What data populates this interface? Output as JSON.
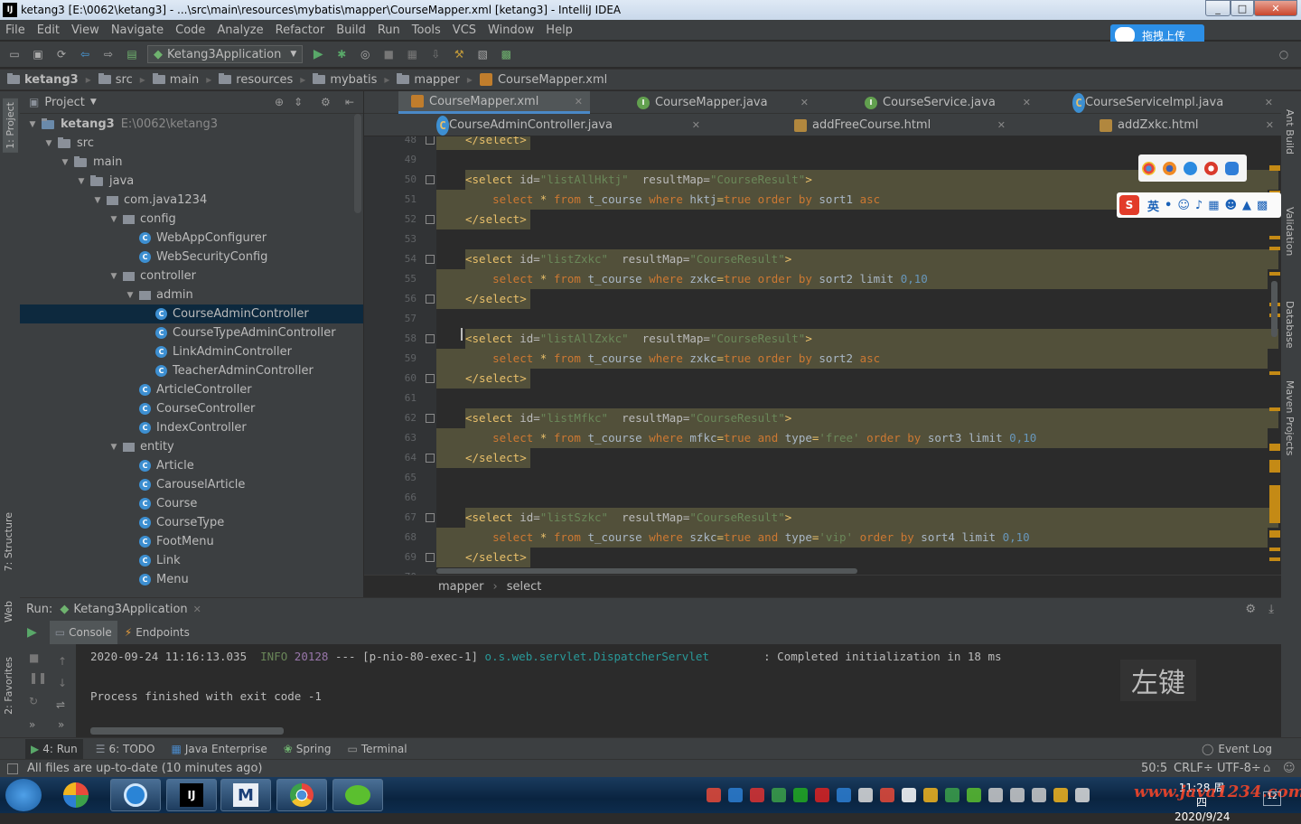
{
  "window": {
    "title": "ketang3 [E:\\0062\\ketang3] - ...\\src\\main\\resources\\mybatis\\mapper\\CourseMapper.xml [ketang3] - IntelliJ IDEA",
    "app_icon": "IJ",
    "controls": [
      "_",
      "□",
      "✕"
    ]
  },
  "menu": [
    "File",
    "Edit",
    "View",
    "Navigate",
    "Code",
    "Analyze",
    "Refactor",
    "Build",
    "Run",
    "Tools",
    "VCS",
    "Window",
    "Help"
  ],
  "upload_button": "拖拽上传",
  "toolbar": {
    "run_config": "Ketang3Application"
  },
  "breadcrumbs": [
    "ketang3",
    "src",
    "main",
    "resources",
    "mybatis",
    "mapper",
    "CourseMapper.xml"
  ],
  "left_strip": {
    "project": "1: Project",
    "structure": "7: Structure",
    "web": "Web",
    "favorites": "2: Favorites"
  },
  "right_strip": {
    "ant": "Ant Build",
    "validation": "Validation",
    "database": "Database",
    "maven": "Maven Projects"
  },
  "project_panel": {
    "title": "Project",
    "root_path": "E:\\0062\\ketang3",
    "tree": [
      {
        "label": "ketang3",
        "kind": "module",
        "depth": 0,
        "open": true
      },
      {
        "label": "src",
        "kind": "folder",
        "depth": 1,
        "open": true
      },
      {
        "label": "main",
        "kind": "folder",
        "depth": 2,
        "open": true
      },
      {
        "label": "java",
        "kind": "folder",
        "depth": 3,
        "open": true
      },
      {
        "label": "com.java1234",
        "kind": "package",
        "depth": 4,
        "open": true
      },
      {
        "label": "config",
        "kind": "package",
        "depth": 5,
        "open": true
      },
      {
        "label": "WebAppConfigurer",
        "kind": "class",
        "depth": 6
      },
      {
        "label": "WebSecurityConfig",
        "kind": "class",
        "depth": 6
      },
      {
        "label": "controller",
        "kind": "package",
        "depth": 5,
        "open": true
      },
      {
        "label": "admin",
        "kind": "package",
        "depth": 6,
        "open": true
      },
      {
        "label": "CourseAdminController",
        "kind": "class",
        "depth": 7,
        "selected": true
      },
      {
        "label": "CourseTypeAdminController",
        "kind": "class",
        "depth": 7
      },
      {
        "label": "LinkAdminController",
        "kind": "class",
        "depth": 7
      },
      {
        "label": "TeacherAdminController",
        "kind": "class",
        "depth": 7
      },
      {
        "label": "ArticleController",
        "kind": "class",
        "depth": 6
      },
      {
        "label": "CourseController",
        "kind": "class",
        "depth": 6
      },
      {
        "label": "IndexController",
        "kind": "class",
        "depth": 6
      },
      {
        "label": "entity",
        "kind": "package",
        "depth": 5,
        "open": true
      },
      {
        "label": "Article",
        "kind": "class",
        "depth": 6
      },
      {
        "label": "CarouselArticle",
        "kind": "class",
        "depth": 6
      },
      {
        "label": "Course",
        "kind": "class",
        "depth": 6
      },
      {
        "label": "CourseType",
        "kind": "class",
        "depth": 6
      },
      {
        "label": "FootMenu",
        "kind": "class",
        "depth": 6
      },
      {
        "label": "Link",
        "kind": "class",
        "depth": 6
      },
      {
        "label": "Menu",
        "kind": "class",
        "depth": 6
      }
    ]
  },
  "editor_tabs_row1": [
    {
      "label": "CourseMapper.xml",
      "type": "xml",
      "active": true
    },
    {
      "label": "CourseMapper.java",
      "type": "interface"
    },
    {
      "label": "CourseService.java",
      "type": "interface"
    },
    {
      "label": "CourseServiceImpl.java",
      "type": "class"
    }
  ],
  "editor_tabs_row2": [
    {
      "label": "CourseAdminController.java",
      "type": "class"
    },
    {
      "label": "addFreeCourse.html",
      "type": "html"
    },
    {
      "label": "addZxkc.html",
      "type": "html"
    }
  ],
  "code": [
    {
      "n": "48",
      "tokens": [
        [
          "tag",
          "</select>"
        ]
      ],
      "hl": true
    },
    {
      "n": "49",
      "tokens": []
    },
    {
      "n": "50",
      "tokens": [
        [
          "tag",
          "<select "
        ],
        [
          "attr",
          "id="
        ],
        [
          "str",
          "\"listAllHktj\""
        ],
        [
          "attr",
          "  resultMap="
        ],
        [
          "str",
          "\"CourseResult\""
        ],
        [
          "tag",
          ">"
        ]
      ],
      "hl": true
    },
    {
      "n": "51",
      "tokens": [
        [
          "kw",
          "    select "
        ],
        [
          "tag",
          "* "
        ],
        [
          "kw",
          "from "
        ],
        [
          "txt",
          "t_course "
        ],
        [
          "kw",
          "where "
        ],
        [
          "txt",
          "hktj"
        ],
        [
          "tag",
          "="
        ],
        [
          "kw",
          "true "
        ],
        [
          "kw",
          "order by "
        ],
        [
          "txt",
          "sort1 "
        ],
        [
          "kw",
          "asc"
        ]
      ],
      "hl": true
    },
    {
      "n": "52",
      "tokens": [
        [
          "tag",
          "</select>"
        ]
      ],
      "hl": true
    },
    {
      "n": "53",
      "tokens": []
    },
    {
      "n": "54",
      "tokens": [
        [
          "tag",
          "<select "
        ],
        [
          "attr",
          "id="
        ],
        [
          "str",
          "\"listZxkc\""
        ],
        [
          "attr",
          "  resultMap="
        ],
        [
          "str",
          "\"CourseResult\""
        ],
        [
          "tag",
          ">"
        ]
      ],
      "hl": true
    },
    {
      "n": "55",
      "tokens": [
        [
          "kw",
          "    select "
        ],
        [
          "tag",
          "* "
        ],
        [
          "kw",
          "from "
        ],
        [
          "txt",
          "t_course "
        ],
        [
          "kw",
          "where "
        ],
        [
          "txt",
          "zxkc"
        ],
        [
          "tag",
          "="
        ],
        [
          "kw",
          "true "
        ],
        [
          "kw",
          "order by "
        ],
        [
          "txt",
          "sort2 limit "
        ],
        [
          "num",
          "0,10"
        ]
      ],
      "hl": true
    },
    {
      "n": "56",
      "tokens": [
        [
          "tag",
          "</select>"
        ]
      ],
      "hl": true
    },
    {
      "n": "57",
      "tokens": []
    },
    {
      "n": "58",
      "tokens": [
        [
          "tag",
          "<select "
        ],
        [
          "attr",
          "id="
        ],
        [
          "str",
          "\"listAllZxkc\""
        ],
        [
          "attr",
          "  resultMap="
        ],
        [
          "str",
          "\"CourseResult\""
        ],
        [
          "tag",
          ">"
        ]
      ],
      "hl": true
    },
    {
      "n": "59",
      "tokens": [
        [
          "kw",
          "    select "
        ],
        [
          "tag",
          "* "
        ],
        [
          "kw",
          "from "
        ],
        [
          "txt",
          "t_course "
        ],
        [
          "kw",
          "where "
        ],
        [
          "txt",
          "zxkc"
        ],
        [
          "tag",
          "="
        ],
        [
          "kw",
          "true "
        ],
        [
          "kw",
          "order by "
        ],
        [
          "txt",
          "sort2 "
        ],
        [
          "kw",
          "asc"
        ]
      ],
      "hl": true
    },
    {
      "n": "60",
      "tokens": [
        [
          "tag",
          "</select>"
        ]
      ],
      "hl": true
    },
    {
      "n": "61",
      "tokens": []
    },
    {
      "n": "62",
      "tokens": [
        [
          "tag",
          "<select "
        ],
        [
          "attr",
          "id="
        ],
        [
          "str",
          "\"listMfkc\""
        ],
        [
          "attr",
          "  resultMap="
        ],
        [
          "str",
          "\"CourseResult\""
        ],
        [
          "tag",
          ">"
        ]
      ],
      "hl": true
    },
    {
      "n": "63",
      "tokens": [
        [
          "kw",
          "    select "
        ],
        [
          "tag",
          "* "
        ],
        [
          "kw",
          "from "
        ],
        [
          "txt",
          "t_course "
        ],
        [
          "kw",
          "where "
        ],
        [
          "txt",
          "mfkc"
        ],
        [
          "tag",
          "="
        ],
        [
          "kw",
          "true and "
        ],
        [
          "txt",
          "type"
        ],
        [
          "tag",
          "="
        ],
        [
          "str",
          "'free' "
        ],
        [
          "kw",
          "order by "
        ],
        [
          "txt",
          "sort3 limit "
        ],
        [
          "num",
          "0,10"
        ]
      ],
      "hl": true
    },
    {
      "n": "64",
      "tokens": [
        [
          "tag",
          "</select>"
        ]
      ],
      "hl": true
    },
    {
      "n": "65",
      "tokens": []
    },
    {
      "n": "66",
      "tokens": []
    },
    {
      "n": "67",
      "tokens": [
        [
          "tag",
          "<select "
        ],
        [
          "attr",
          "id="
        ],
        [
          "str",
          "\"listSzkc\""
        ],
        [
          "attr",
          "  resultMap="
        ],
        [
          "str",
          "\"CourseResult\""
        ],
        [
          "tag",
          ">"
        ]
      ],
      "hl": true
    },
    {
      "n": "68",
      "tokens": [
        [
          "kw",
          "    select "
        ],
        [
          "tag",
          "* "
        ],
        [
          "kw",
          "from "
        ],
        [
          "txt",
          "t_course "
        ],
        [
          "kw",
          "where "
        ],
        [
          "txt",
          "szkc"
        ],
        [
          "tag",
          "="
        ],
        [
          "kw",
          "true and "
        ],
        [
          "txt",
          "type"
        ],
        [
          "tag",
          "="
        ],
        [
          "str",
          "'vip' "
        ],
        [
          "kw",
          "order by "
        ],
        [
          "txt",
          "sort4 limit "
        ],
        [
          "num",
          "0,10"
        ]
      ],
      "hl": true
    },
    {
      "n": "69",
      "tokens": [
        [
          "tag",
          "</select>"
        ]
      ],
      "hl": true
    },
    {
      "n": "70",
      "tokens": []
    }
  ],
  "editor_breadcrumb": [
    "mapper",
    "select"
  ],
  "run_panel": {
    "label": "Run:",
    "config": "Ketang3Application",
    "tabs": [
      "Console",
      "Endpoints"
    ],
    "console_lines": [
      {
        "ts": "2020-09-24 11:16:13.035",
        "level": "INFO",
        "pid": "20128",
        "mid": "--- [p-nio-80-exec-1]",
        "logger": "o.s.web.servlet.DispatcherServlet",
        "msg": ": Completed initialization in 18 ms"
      },
      {
        "plain": ""
      },
      {
        "plain": "Process finished with exit code -1"
      }
    ]
  },
  "key_hint": "左键",
  "bottom_tabs": [
    "4: Run",
    "6: TODO",
    "Java Enterprise",
    "Spring",
    "Terminal"
  ],
  "event_log": "Event Log",
  "status": {
    "message": "All files are up-to-date (10 minutes ago)",
    "position": "50:5",
    "line_sep": "CRLF÷",
    "encoding": "UTF-8÷"
  },
  "ime": {
    "mode": "英"
  },
  "clock": {
    "time": "11:28 周四",
    "date": "2020/9/24"
  },
  "watermark": "www.java1234.com"
}
